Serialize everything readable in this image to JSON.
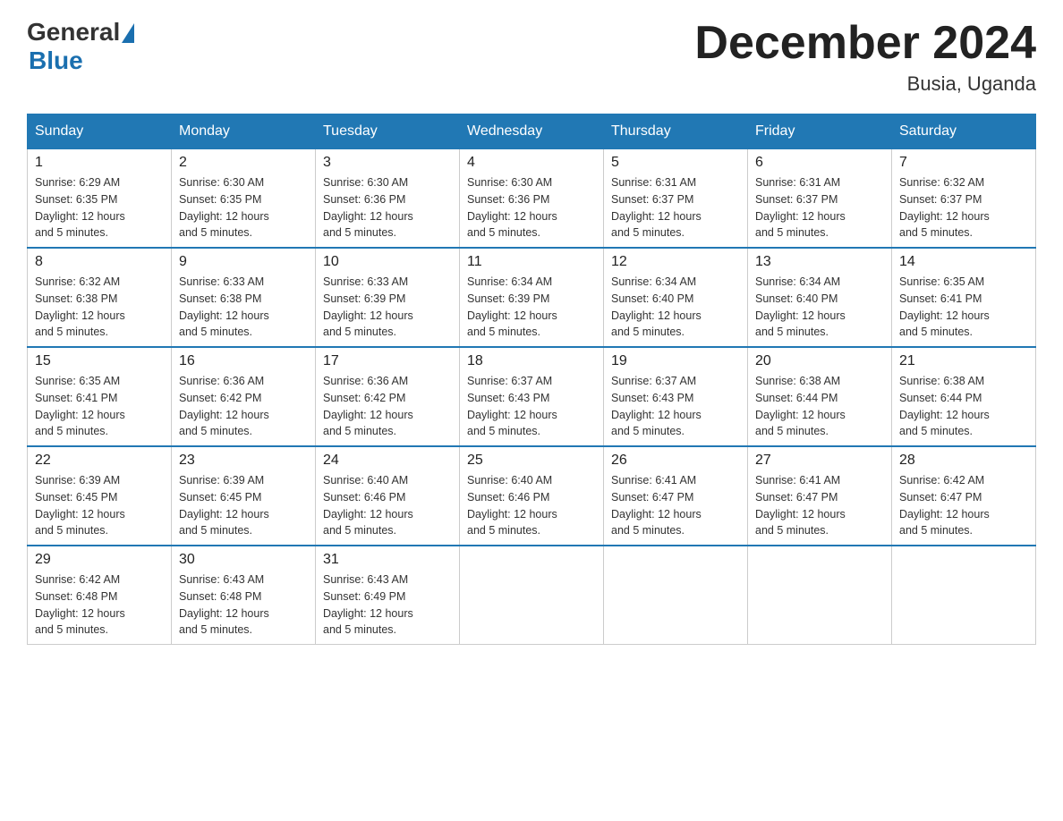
{
  "header": {
    "logo_general": "General",
    "logo_blue": "Blue",
    "month_title": "December 2024",
    "location": "Busia, Uganda"
  },
  "weekdays": [
    "Sunday",
    "Monday",
    "Tuesday",
    "Wednesday",
    "Thursday",
    "Friday",
    "Saturday"
  ],
  "weeks": [
    [
      {
        "day": "1",
        "sunrise": "6:29 AM",
        "sunset": "6:35 PM",
        "daylight": "12 hours and 5 minutes."
      },
      {
        "day": "2",
        "sunrise": "6:30 AM",
        "sunset": "6:35 PM",
        "daylight": "12 hours and 5 minutes."
      },
      {
        "day": "3",
        "sunrise": "6:30 AM",
        "sunset": "6:36 PM",
        "daylight": "12 hours and 5 minutes."
      },
      {
        "day": "4",
        "sunrise": "6:30 AM",
        "sunset": "6:36 PM",
        "daylight": "12 hours and 5 minutes."
      },
      {
        "day": "5",
        "sunrise": "6:31 AM",
        "sunset": "6:37 PM",
        "daylight": "12 hours and 5 minutes."
      },
      {
        "day": "6",
        "sunrise": "6:31 AM",
        "sunset": "6:37 PM",
        "daylight": "12 hours and 5 minutes."
      },
      {
        "day": "7",
        "sunrise": "6:32 AM",
        "sunset": "6:37 PM",
        "daylight": "12 hours and 5 minutes."
      }
    ],
    [
      {
        "day": "8",
        "sunrise": "6:32 AM",
        "sunset": "6:38 PM",
        "daylight": "12 hours and 5 minutes."
      },
      {
        "day": "9",
        "sunrise": "6:33 AM",
        "sunset": "6:38 PM",
        "daylight": "12 hours and 5 minutes."
      },
      {
        "day": "10",
        "sunrise": "6:33 AM",
        "sunset": "6:39 PM",
        "daylight": "12 hours and 5 minutes."
      },
      {
        "day": "11",
        "sunrise": "6:34 AM",
        "sunset": "6:39 PM",
        "daylight": "12 hours and 5 minutes."
      },
      {
        "day": "12",
        "sunrise": "6:34 AM",
        "sunset": "6:40 PM",
        "daylight": "12 hours and 5 minutes."
      },
      {
        "day": "13",
        "sunrise": "6:34 AM",
        "sunset": "6:40 PM",
        "daylight": "12 hours and 5 minutes."
      },
      {
        "day": "14",
        "sunrise": "6:35 AM",
        "sunset": "6:41 PM",
        "daylight": "12 hours and 5 minutes."
      }
    ],
    [
      {
        "day": "15",
        "sunrise": "6:35 AM",
        "sunset": "6:41 PM",
        "daylight": "12 hours and 5 minutes."
      },
      {
        "day": "16",
        "sunrise": "6:36 AM",
        "sunset": "6:42 PM",
        "daylight": "12 hours and 5 minutes."
      },
      {
        "day": "17",
        "sunrise": "6:36 AM",
        "sunset": "6:42 PM",
        "daylight": "12 hours and 5 minutes."
      },
      {
        "day": "18",
        "sunrise": "6:37 AM",
        "sunset": "6:43 PM",
        "daylight": "12 hours and 5 minutes."
      },
      {
        "day": "19",
        "sunrise": "6:37 AM",
        "sunset": "6:43 PM",
        "daylight": "12 hours and 5 minutes."
      },
      {
        "day": "20",
        "sunrise": "6:38 AM",
        "sunset": "6:44 PM",
        "daylight": "12 hours and 5 minutes."
      },
      {
        "day": "21",
        "sunrise": "6:38 AM",
        "sunset": "6:44 PM",
        "daylight": "12 hours and 5 minutes."
      }
    ],
    [
      {
        "day": "22",
        "sunrise": "6:39 AM",
        "sunset": "6:45 PM",
        "daylight": "12 hours and 5 minutes."
      },
      {
        "day": "23",
        "sunrise": "6:39 AM",
        "sunset": "6:45 PM",
        "daylight": "12 hours and 5 minutes."
      },
      {
        "day": "24",
        "sunrise": "6:40 AM",
        "sunset": "6:46 PM",
        "daylight": "12 hours and 5 minutes."
      },
      {
        "day": "25",
        "sunrise": "6:40 AM",
        "sunset": "6:46 PM",
        "daylight": "12 hours and 5 minutes."
      },
      {
        "day": "26",
        "sunrise": "6:41 AM",
        "sunset": "6:47 PM",
        "daylight": "12 hours and 5 minutes."
      },
      {
        "day": "27",
        "sunrise": "6:41 AM",
        "sunset": "6:47 PM",
        "daylight": "12 hours and 5 minutes."
      },
      {
        "day": "28",
        "sunrise": "6:42 AM",
        "sunset": "6:47 PM",
        "daylight": "12 hours and 5 minutes."
      }
    ],
    [
      {
        "day": "29",
        "sunrise": "6:42 AM",
        "sunset": "6:48 PM",
        "daylight": "12 hours and 5 minutes."
      },
      {
        "day": "30",
        "sunrise": "6:43 AM",
        "sunset": "6:48 PM",
        "daylight": "12 hours and 5 minutes."
      },
      {
        "day": "31",
        "sunrise": "6:43 AM",
        "sunset": "6:49 PM",
        "daylight": "12 hours and 5 minutes."
      },
      null,
      null,
      null,
      null
    ]
  ]
}
